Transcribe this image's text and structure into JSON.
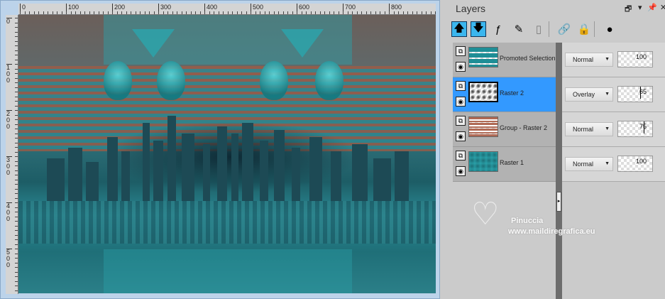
{
  "ruler": {
    "h": [
      "0",
      "100",
      "200",
      "300",
      "400",
      "500",
      "600",
      "700",
      "800"
    ],
    "v": [
      "0",
      "100",
      "200",
      "300",
      "400",
      "500"
    ]
  },
  "panel": {
    "title": "Layers",
    "buttons": {
      "restore": "🗗",
      "menu": "▾",
      "pin": "📌",
      "close": "✕"
    }
  },
  "toolbar": [
    {
      "name": "move-layer-up-icon",
      "glyph": "🡅"
    },
    {
      "name": "move-layer-down-icon",
      "glyph": "🡇"
    },
    {
      "name": "layer-effects-visibility-icon",
      "glyph": "ƒ"
    },
    {
      "name": "edit-layer-icon",
      "glyph": "✎"
    },
    {
      "name": "disabled-layer-icon",
      "glyph": "▯"
    },
    {
      "name": "link-icon",
      "glyph": "🔗"
    },
    {
      "name": "lock-icon",
      "glyph": "🔒"
    },
    {
      "name": "bubble-icon",
      "glyph": "●"
    }
  ],
  "layers": [
    {
      "name": "Promoted Selection",
      "blend": "Normal",
      "opacity": "100",
      "selected": false
    },
    {
      "name": "Raster 2",
      "blend": "Overlay",
      "opacity": "65",
      "selected": true
    },
    {
      "name": "Group - Raster 2",
      "blend": "Normal",
      "opacity": "75",
      "selected": false
    },
    {
      "name": "Raster 1",
      "blend": "Normal",
      "opacity": "100",
      "selected": false
    }
  ],
  "watermark": {
    "name": "Pinuccia",
    "url": "www.maildiregrafica.eu"
  },
  "colors": {
    "selected": "#3399ff",
    "teal": "#2ba2aa",
    "rust": "#a25a43"
  }
}
